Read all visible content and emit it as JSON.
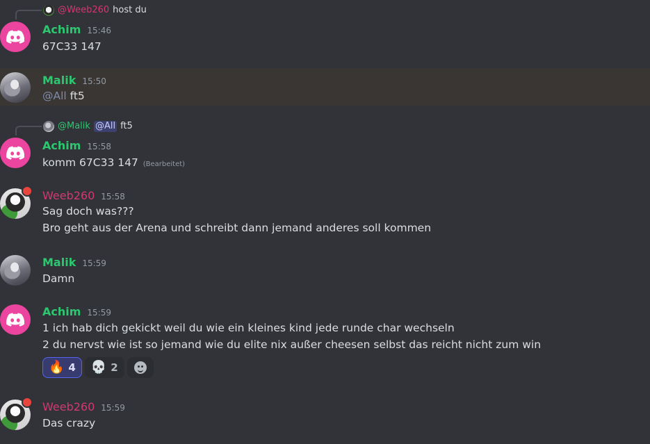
{
  "messages": [
    {
      "reply": {
        "mention": "@Weeb260",
        "text": "host du"
      },
      "author": "Achim",
      "time": "15:46",
      "lines": [
        "67C33 147"
      ]
    },
    {
      "author": "Malik",
      "time": "15:50",
      "mention": "@All",
      "text": "ft5",
      "highlighted": true
    },
    {
      "reply": {
        "mention": "@Malik",
        "pill": "@All",
        "text": "ft5"
      },
      "author": "Achim",
      "time": "15:58",
      "lines": [
        "komm 67C33 147"
      ],
      "edited": "(Bearbeitet)"
    },
    {
      "author": "Weeb260",
      "time": "15:58",
      "lines": [
        "Sag doch was???",
        "Bro geht aus der Arena und schreibt dann jemand anderes soll kommen"
      ]
    },
    {
      "author": "Malik",
      "time": "15:59",
      "lines": [
        "Damn"
      ]
    },
    {
      "author": "Achim",
      "time": "15:59",
      "lines": [
        "1 ich hab dich gekickt weil du wie ein kleines kind jede runde char wechseln",
        "2 du nervst wie ist so jemand wie du elite nix außer cheesen selbst das reicht nicht zum win"
      ],
      "reactions": [
        {
          "emoji": "🔥",
          "icon": "fire-icon",
          "count": "4",
          "active": true
        },
        {
          "emoji": "💀",
          "icon": "skull-icon",
          "count": "2",
          "active": false
        }
      ]
    },
    {
      "author": "Weeb260",
      "time": "15:59",
      "lines": [
        "Das crazy"
      ]
    }
  ],
  "colors": {
    "background": "#313338",
    "username_green": "#2dc770",
    "username_pink": "#d4386f",
    "discord_avatar": "#eb459f",
    "highlight": "#3a3634",
    "reaction_active": "#5865f2"
  }
}
